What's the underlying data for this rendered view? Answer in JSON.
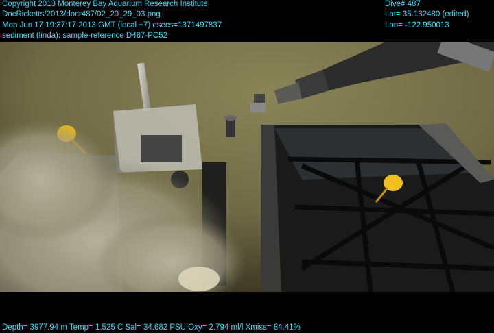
{
  "overlay": {
    "copyright": "Copyright 2013 Monterey Bay Aquarium Research Institute",
    "file": "DocRicketts/2013/docr487/02_20_29_03.png",
    "timestamp": "Mon Jun 17 19:37:17 2013 GMT (local +7)  esecs=1371497837",
    "annotation": "sediment (linda): sample-reference D487-PC52",
    "dive": "Dive# 487",
    "latitude": "Lat= 35.132480 (edited)",
    "longitude": "Lon= -122.950013",
    "sensors": "Depth= 3977.94 m  Temp= 1.525 C  Sal= 34.682 PSU  Oxy= 2.794 ml/l  Xmiss= 84.41%"
  },
  "colors": {
    "overlay_text": "#2fe0ff",
    "seafloor": "#6f6a45",
    "sediment_plume": "#a8a590",
    "float": "#f0c020"
  },
  "scene": {
    "description_icons": [
      "robotic-arm-icon",
      "sample-frame-icon",
      "core-rack-icon",
      "yellow-float-icon",
      "sediment-plume-icon"
    ]
  }
}
